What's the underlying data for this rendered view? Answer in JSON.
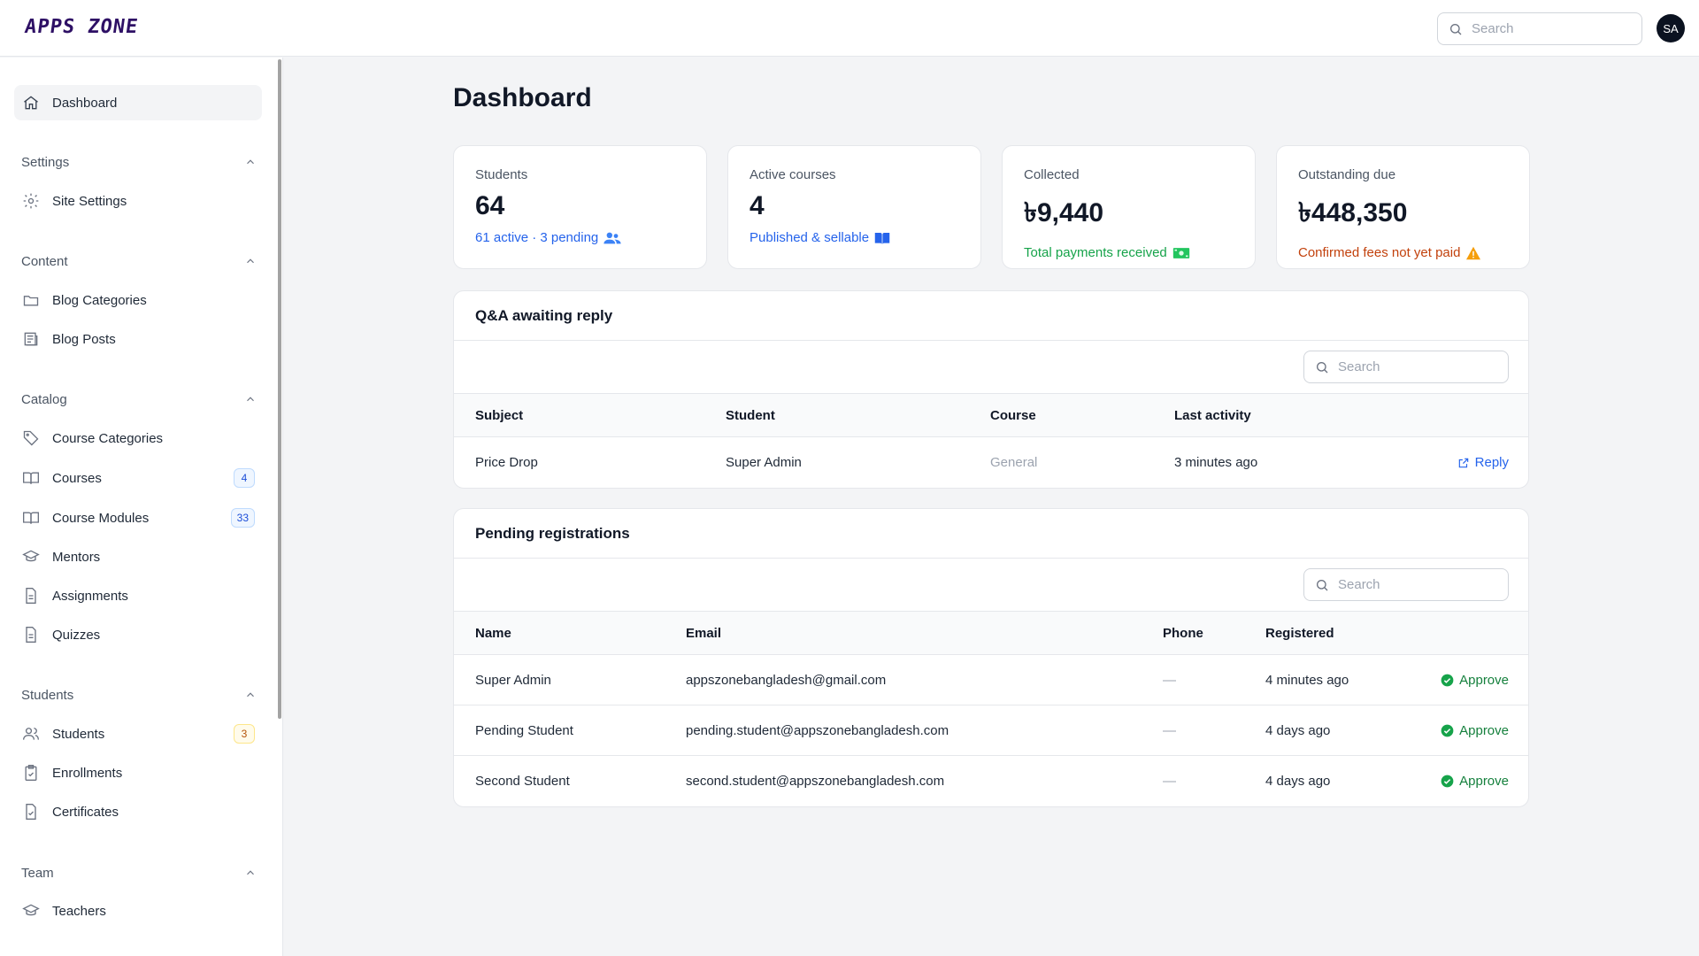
{
  "brand": "APPS ZONE",
  "search": {
    "placeholder": "Search"
  },
  "user": {
    "initials": "SA"
  },
  "sidebar": {
    "dashboard": "Dashboard",
    "groups": {
      "settings": "Settings",
      "content": "Content",
      "catalog": "Catalog",
      "students": "Students",
      "team": "Team"
    },
    "items": {
      "site_settings": "Site Settings",
      "blog_categories": "Blog Categories",
      "blog_posts": "Blog Posts",
      "course_categories": "Course Categories",
      "courses": "Courses",
      "courses_badge": "4",
      "course_modules": "Course Modules",
      "course_modules_badge": "33",
      "mentors": "Mentors",
      "assignments": "Assignments",
      "quizzes": "Quizzes",
      "students": "Students",
      "students_badge": "3",
      "enrollments": "Enrollments",
      "certificates": "Certificates",
      "teachers": "Teachers"
    }
  },
  "page": {
    "title": "Dashboard"
  },
  "stats": {
    "students": {
      "label": "Students",
      "value": "64",
      "sub": "61 active · 3 pending"
    },
    "courses": {
      "label": "Active courses",
      "value": "4",
      "sub": "Published & sellable"
    },
    "collected": {
      "label": "Collected",
      "value": "৳9,440",
      "sub": "Total payments received"
    },
    "due": {
      "label": "Outstanding due",
      "value": "৳448,350",
      "sub": "Confirmed fees not yet paid"
    }
  },
  "qa": {
    "title": "Q&A awaiting reply",
    "search_placeholder": "Search",
    "columns": {
      "subject": "Subject",
      "student": "Student",
      "course": "Course",
      "last_activity": "Last activity"
    },
    "rows": [
      {
        "subject": "Price Drop",
        "student": "Super Admin",
        "course": "General",
        "last_activity": "3 minutes ago",
        "action": "Reply"
      }
    ]
  },
  "pending": {
    "title": "Pending registrations",
    "search_placeholder": "Search",
    "columns": {
      "name": "Name",
      "email": "Email",
      "phone": "Phone",
      "registered": "Registered"
    },
    "rows": [
      {
        "name": "Super Admin",
        "email": "appszonebangladesh@gmail.com",
        "phone": "—",
        "registered": "4 minutes ago",
        "action": "Approve"
      },
      {
        "name": "Pending Student",
        "email": "pending.student@appszonebangladesh.com",
        "phone": "—",
        "registered": "4 days ago",
        "action": "Approve"
      },
      {
        "name": "Second Student",
        "email": "second.student@appszonebangladesh.com",
        "phone": "—",
        "registered": "4 days ago",
        "action": "Approve"
      }
    ]
  },
  "colors": {
    "accent": "#2563eb",
    "success": "#16a34a",
    "warning": "#c2410c",
    "brand": "#2e1065"
  }
}
